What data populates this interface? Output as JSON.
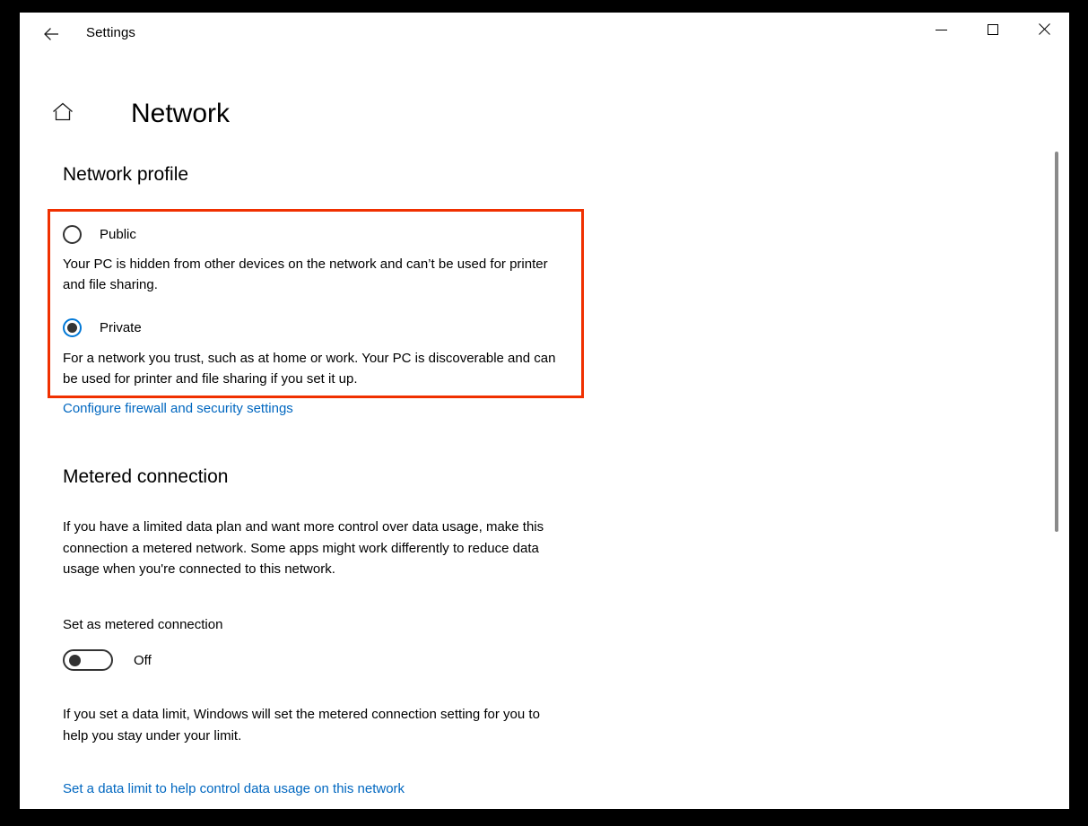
{
  "window": {
    "titlebar": {
      "title": "Settings",
      "back_icon": "arrow-left-icon",
      "minimize_label": "Minimize",
      "maximize_label": "Maximize",
      "close_label": "Close"
    },
    "header": {
      "home_icon": "home-icon",
      "title": "Network"
    }
  },
  "network_profile": {
    "heading": "Network profile",
    "options": [
      {
        "label": "Public",
        "description": "Your PC is hidden from other devices on the network and can’t be used for printer and file sharing.",
        "selected": false
      },
      {
        "label": "Private",
        "description": "For a network you trust, such as at home or work. Your PC is discoverable and can be used for printer and file sharing if you set it up.",
        "selected": true
      }
    ],
    "firewall_link": "Configure firewall and security settings",
    "highlight_color": "#f03000",
    "selected_radio_color": "#0078d7"
  },
  "metered_connection": {
    "heading": "Metered connection",
    "description": "If you have a limited data plan and want more control over data usage, make this connection a metered network. Some apps might work differently to reduce data usage when you're connected to this network.",
    "toggle_label": "Set as metered connection",
    "toggle_state": "Off",
    "limit_description": "If you set a data limit, Windows will set the metered connection setting for you to help you stay under your limit.",
    "data_limit_link": "Set a data limit to help control data usage on this network"
  },
  "colors": {
    "link": "#0067c0",
    "text": "#000000",
    "background": "#ffffff"
  }
}
